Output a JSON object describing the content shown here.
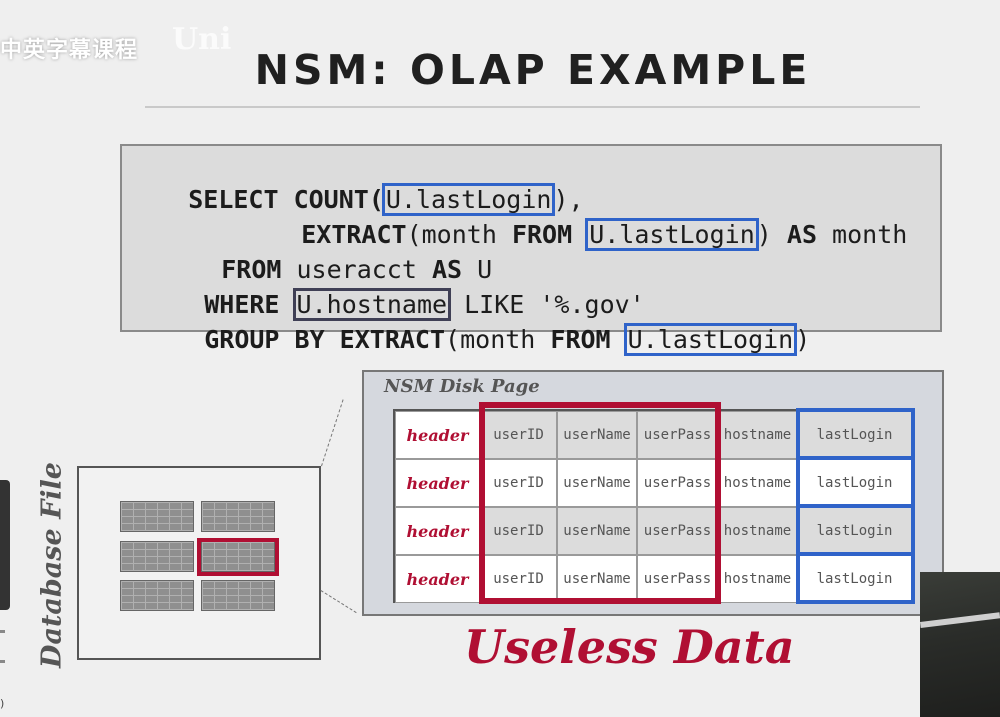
{
  "watermark": {
    "text": "中英字幕课程",
    "ghost": "Uni"
  },
  "slide": {
    "title": "NSM: OLAP EXAMPLE"
  },
  "sql": {
    "l1_kw": "SELECT COUNT(",
    "l1_hl": "U.lastLogin",
    "l1_tail": "),",
    "l2_kw1": "EXTRACT",
    "l2_a": "(month ",
    "l2_kw2": "FROM ",
    "l2_hl": "U.lastLogin",
    "l2_b": ") ",
    "l2_kw3": "AS",
    "l2_c": " month",
    "l3_kw1": "FROM",
    "l3_a": " useracct ",
    "l3_kw2": "AS",
    "l3_b": " U",
    "l4_kw1": "WHERE",
    "l4_hl": "U.hostname",
    "l4_a": " LIKE '%.gov'",
    "l5_kw1": "GROUP BY EXTRACT",
    "l5_a": "(month ",
    "l5_kw2": "FROM ",
    "l5_hl": "U.lastLogin",
    "l5_b": ")"
  },
  "database_file": {
    "label": "Database File"
  },
  "disk_page": {
    "title": "NSM Disk Page",
    "rows": [
      {
        "header": "header",
        "userID": "userID",
        "userName": "userName",
        "userPass": "userPass",
        "hostname": "hostname",
        "lastLogin": "lastLogin"
      },
      {
        "header": "header",
        "userID": "userID",
        "userName": "userName",
        "userPass": "userPass",
        "hostname": "hostname",
        "lastLogin": "lastLogin"
      },
      {
        "header": "header",
        "userID": "userID",
        "userName": "userName",
        "userPass": "userPass",
        "hostname": "hostname",
        "lastLogin": "lastLogin"
      },
      {
        "header": "header",
        "userID": "userID",
        "userName": "userName",
        "userPass": "userPass",
        "hostname": "hostname",
        "lastLogin": "lastLogin"
      }
    ]
  },
  "annotation": {
    "useless": "Useless Data"
  },
  "corner": {
    "glyph": ")"
  },
  "colors": {
    "accent_red": "#b00f33",
    "accent_blue": "#2f63c9",
    "dark_outline": "#3f3f55"
  }
}
